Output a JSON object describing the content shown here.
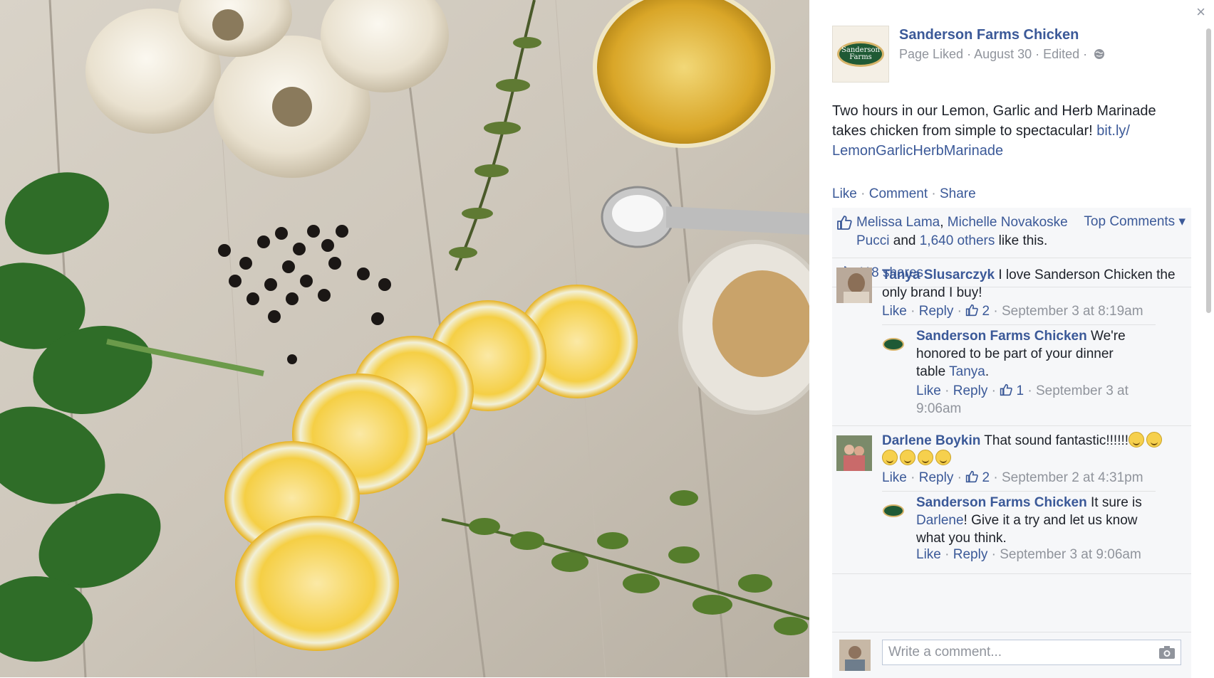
{
  "post": {
    "page_name": "Sanderson Farms Chicken",
    "logo_text": "Sanderson Farms",
    "meta": "Page Liked · August 30 · Edited ·",
    "text_before_link": "Two hours in our Lemon, Garlic and Herb Marinade takes chicken from simple to spectacular! ",
    "link": "bit.ly/ LemonGarlicHerbMarinade"
  },
  "actions": {
    "like": "Like",
    "comment": "Comment",
    "share": "Share",
    "sep": "·"
  },
  "likes": {
    "names_part1": "Melissa Lama",
    "comma": ", ",
    "names_part2": "Michelle Novakoske Pucci",
    "and": " and ",
    "others": "1,640 others",
    "suffix": " like this.",
    "top_comments": "Top Comments ▾"
  },
  "shares": {
    "label": "418 shares"
  },
  "comments": [
    {
      "author": "Tanya Slusarczyk",
      "text": "I love Sanderson Chicken the only brand I buy!",
      "like": "Like",
      "reply": "Reply",
      "likes_count": "2",
      "time": "September 3 at 8:19am",
      "reply_comment": {
        "author": "Sanderson Farms Chicken",
        "text_before": "We're honored to be part of your dinner table ",
        "mention": "Tanya",
        "text_after": ".",
        "like": "Like",
        "reply": "Reply",
        "likes_count": "1",
        "time": "September 3 at 9:06am"
      }
    },
    {
      "author": "Darlene Boykin",
      "text": "That sound fantastic!!!!!!",
      "like": "Like",
      "reply": "Reply",
      "likes_count": "2",
      "time": "September 2 at 4:31pm",
      "reply_comment": {
        "author": "Sanderson Farms Chicken",
        "text_before": "It sure is ",
        "mention": "Darlene",
        "text_after": "! Give it a try and let us know what you think.",
        "like": "Like",
        "reply": "Reply",
        "time": "September 3 at 9:06am"
      }
    }
  ],
  "write_comment": {
    "placeholder": "Write a comment..."
  },
  "close_label": "×",
  "colors": {
    "link": "#3b5998",
    "muted": "#90949c",
    "panel_bg": "#f6f7f9"
  }
}
